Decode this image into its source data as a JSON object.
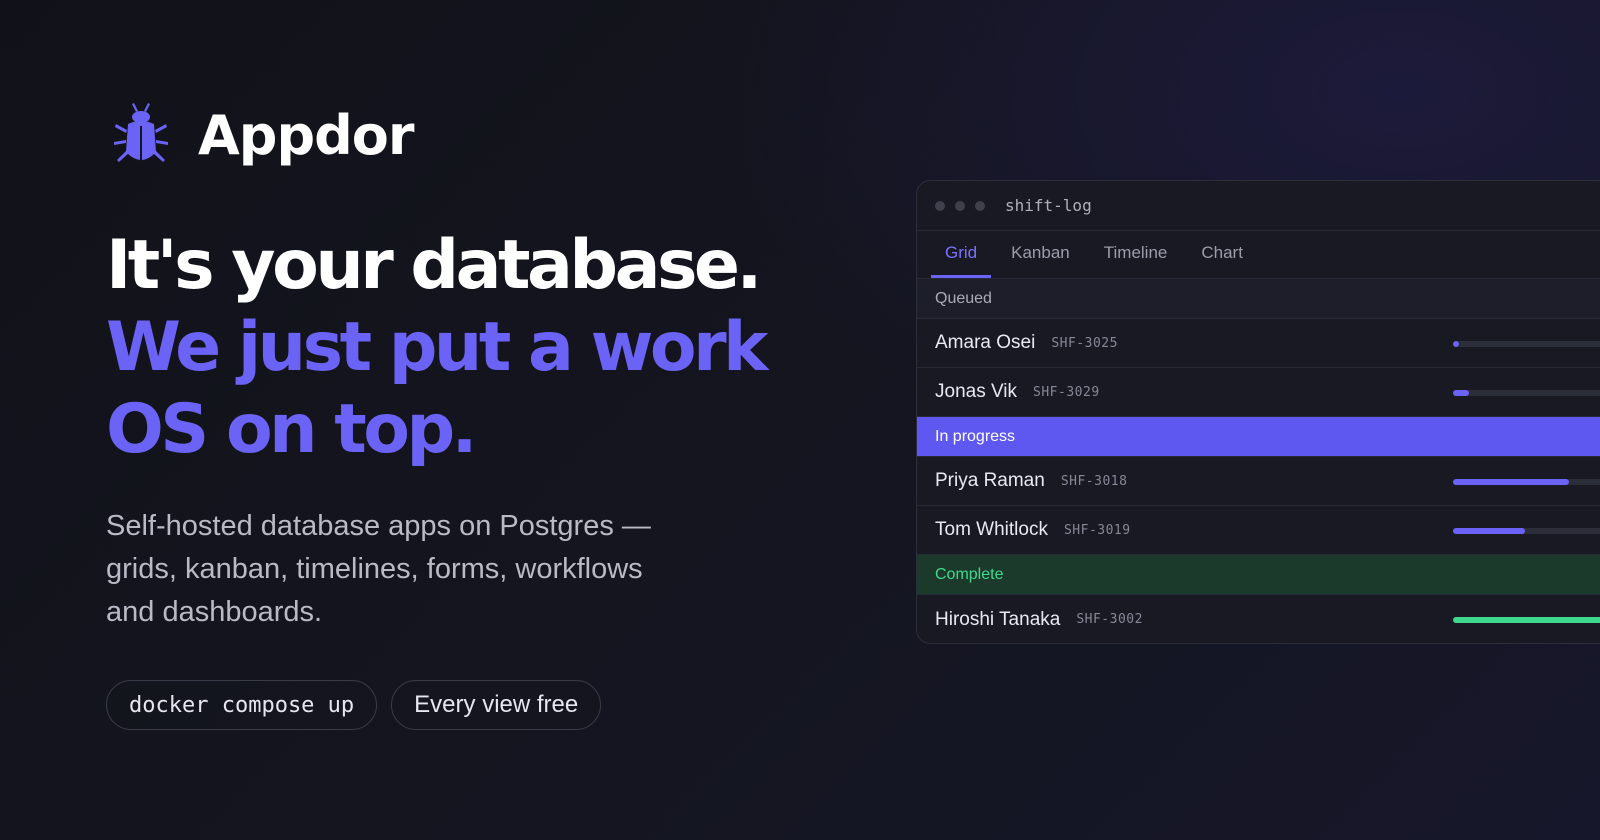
{
  "brand": {
    "name": "Appdor",
    "logo_icon": "beetle-icon",
    "accent": "#6b63f5"
  },
  "hero": {
    "line1": "It's your database.",
    "line2a": "We just put a work",
    "line2b": "OS on top.",
    "subtitle": "Self-hosted database apps on Postgres — grids, kanban, timelines, forms, workflows and dashboards."
  },
  "pills": [
    {
      "label": "docker compose up"
    },
    {
      "label": "Every view free"
    }
  ],
  "window": {
    "title": "shift-log",
    "tabs": [
      {
        "label": "Grid",
        "active": true
      },
      {
        "label": "Kanban",
        "active": false
      },
      {
        "label": "Timeline",
        "active": false
      },
      {
        "label": "Chart",
        "active": false
      }
    ],
    "groups": [
      {
        "label": "Queued",
        "color": "#a9abb8",
        "rows": [
          {
            "name": "Amara Osei",
            "id": "SHF-3025",
            "progress": 0.03
          },
          {
            "name": "Jonas Vik",
            "id": "SHF-3029",
            "progress": 0.08
          }
        ]
      },
      {
        "label": "In progress",
        "color": "#5f58f0",
        "rows": [
          {
            "name": "Priya Raman",
            "id": "SHF-3018",
            "progress": 0.58
          },
          {
            "name": "Tom Whitlock",
            "id": "SHF-3019",
            "progress": 0.36
          }
        ]
      },
      {
        "label": "Complete",
        "color": "#3fd98d",
        "rows": [
          {
            "name": "Hiroshi Tanaka",
            "id": "SHF-3002",
            "progress": 1.0
          }
        ]
      }
    ]
  }
}
